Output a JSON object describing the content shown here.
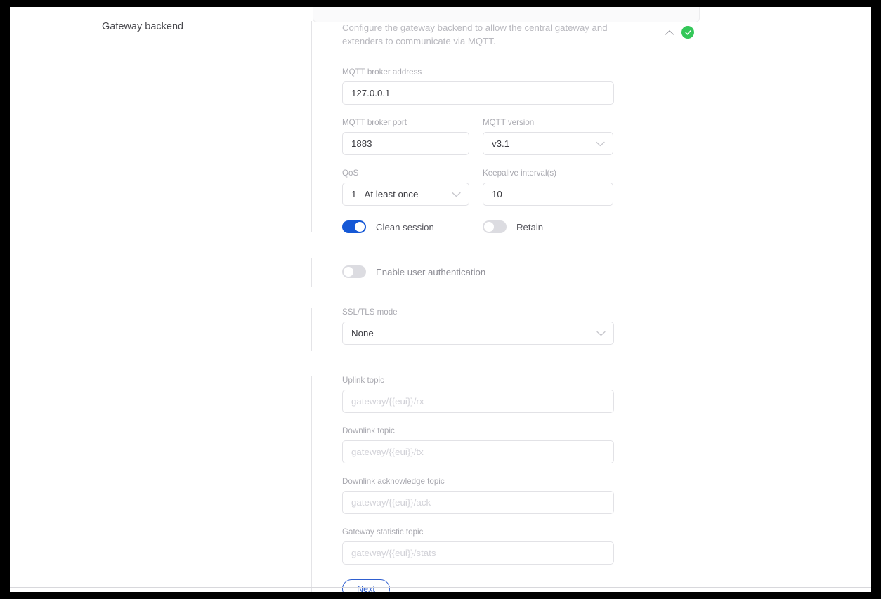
{
  "page": {
    "section_title": "Gateway backend",
    "description": "Configure the gateway backend to allow the central gateway and extenders to communicate via MQTT."
  },
  "header_icons": {
    "collapse": "chevron-up-icon",
    "status": "check-circle-icon",
    "status_color": "#34c759"
  },
  "fields": {
    "broker_address": {
      "label": "MQTT broker address",
      "value": "127.0.0.1"
    },
    "broker_port": {
      "label": "MQTT broker port",
      "value": "1883"
    },
    "mqtt_version": {
      "label": "MQTT version",
      "value": "v3.1"
    },
    "qos": {
      "label": "QoS",
      "value": "1 - At least once"
    },
    "keepalive": {
      "label": "Keepalive interval(s)",
      "value": "10"
    },
    "ssl_tls_mode": {
      "label": "SSL/TLS mode",
      "value": "None"
    },
    "uplink_topic": {
      "label": "Uplink topic",
      "value": "",
      "placeholder": "gateway/{{eui}}/rx"
    },
    "downlink_topic": {
      "label": "Downlink topic",
      "value": "",
      "placeholder": "gateway/{{eui}}/tx"
    },
    "downlink_ack_topic": {
      "label": "Downlink acknowledge topic",
      "value": "",
      "placeholder": "gateway/{{eui}}/ack"
    },
    "gateway_statistic_topic": {
      "label": "Gateway statistic topic",
      "value": "",
      "placeholder": "gateway/{{eui}}/stats"
    }
  },
  "toggles": {
    "clean_session": {
      "label": "Clean session",
      "state": "on"
    },
    "retain": {
      "label": "Retain",
      "state": "off"
    },
    "user_authentication": {
      "label": "Enable user authentication",
      "state": "off"
    }
  },
  "actions": {
    "next_label": "Next"
  },
  "colors": {
    "accent_blue": "#1558d6",
    "button_blue": "#2f5fd0",
    "status_green": "#34c759"
  }
}
